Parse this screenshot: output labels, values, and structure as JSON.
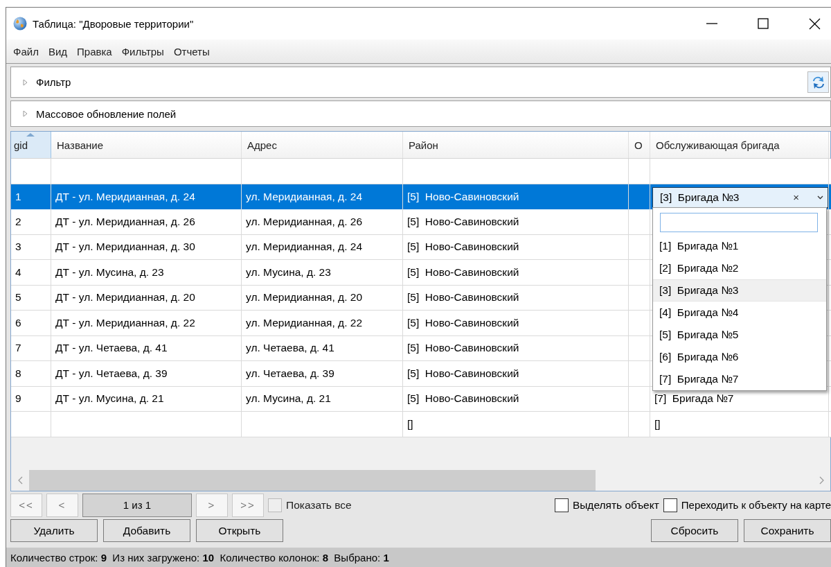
{
  "window": {
    "title": "Таблица: \"Дворовые территории\""
  },
  "menu": [
    "Файл",
    "Вид",
    "Правка",
    "Фильтры",
    "Отчеты"
  ],
  "filter_panel": {
    "label": "Фильтр",
    "expanded": false
  },
  "mass_update_panel": {
    "label": "Массовое обновление полей",
    "expanded": false
  },
  "table": {
    "columns": [
      {
        "label": "gid",
        "sorted": true
      },
      {
        "label": "Название"
      },
      {
        "label": "Адрес"
      },
      {
        "label": "Район"
      },
      {
        "label": "О"
      },
      {
        "label": "Обслуживающая бригада"
      }
    ],
    "rows": [
      {
        "selected": true,
        "gid": "1",
        "name": "ДТ - ул. Меридианная, д. 24",
        "address": "ул. Меридианная, д. 24",
        "district": "[5]  Ново-Савиновский",
        "editor": {
          "value": "[3]  Бригада №3",
          "clear": "×",
          "options": [
            {
              "label": "[1]  Бригада №1",
              "selected": false
            },
            {
              "label": "[2]  Бригада №2",
              "selected": false
            },
            {
              "label": "[3]  Бригада №3",
              "selected": true
            },
            {
              "label": "[4]  Бригада №4",
              "selected": false
            },
            {
              "label": "[5]  Бригада №5",
              "selected": false
            },
            {
              "label": "[6]  Бригада №6",
              "selected": false
            },
            {
              "label": "[7]  Бригада №7",
              "selected": false
            }
          ]
        }
      },
      {
        "selected": false,
        "gid": "2",
        "name": "ДТ - ул. Меридианная, д. 26",
        "address": "ул. Меридианная, д. 26",
        "district": "[5]  Ново-Савиновский"
      },
      {
        "selected": false,
        "gid": "3",
        "name": "ДТ - ул. Меридианная, д. 30",
        "address": "ул. Меридианная, д. 24",
        "district": "[5]  Ново-Савиновский"
      },
      {
        "selected": false,
        "gid": "4",
        "name": "ДТ - ул. Мусина, д. 23",
        "address": "ул. Мусина, д. 23",
        "district": "[5]  Ново-Савиновский"
      },
      {
        "selected": false,
        "gid": "5",
        "name": "ДТ - ул. Меридианная, д. 20",
        "address": "ул. Меридианная, д. 20",
        "district": "[5]  Ново-Савиновский"
      },
      {
        "selected": false,
        "gid": "6",
        "name": "ДТ - ул. Меридианная, д. 22",
        "address": "ул. Меридианная, д. 22",
        "district": "[5]  Ново-Савиновский"
      },
      {
        "selected": false,
        "gid": "7",
        "name": "ДТ - ул. Четаева, д. 41",
        "address": "ул. Четаева, д. 41",
        "district": "[5]  Ново-Савиновский"
      },
      {
        "selected": false,
        "gid": "8",
        "name": "ДТ - ул. Четаева, д. 39",
        "address": "ул. Четаева, д. 39",
        "district": "[5]  Ново-Савиновский"
      },
      {
        "selected": false,
        "gid": "9",
        "name": "ДТ - ул. Мусина, д. 21",
        "address": "ул. Мусина, д. 21",
        "district": "[5]  Ново-Савиновский",
        "brigade": "[7]  Бригада №7"
      },
      {
        "selected": false,
        "district": "[]",
        "brigade": "[]"
      }
    ]
  },
  "pager": {
    "first": "<<",
    "prev": "<",
    "page": "1 из 1",
    "next": ">",
    "last": ">>",
    "show_all": {
      "label": "Показать все",
      "checked": false,
      "disabled": true
    }
  },
  "options": [
    {
      "label": "Выделять объект",
      "checked": false
    },
    {
      "label": "Переходить к объекту на карте",
      "checked": false
    }
  ],
  "actions_left": [
    "Удалить",
    "Добавить",
    "Открыть"
  ],
  "actions_right": [
    "Сбросить",
    "Сохранить"
  ],
  "status_bar": "Количество строк: **9**  Из них загружено: **10**  Количество колонок: **8**  Выбрано: **1**"
}
